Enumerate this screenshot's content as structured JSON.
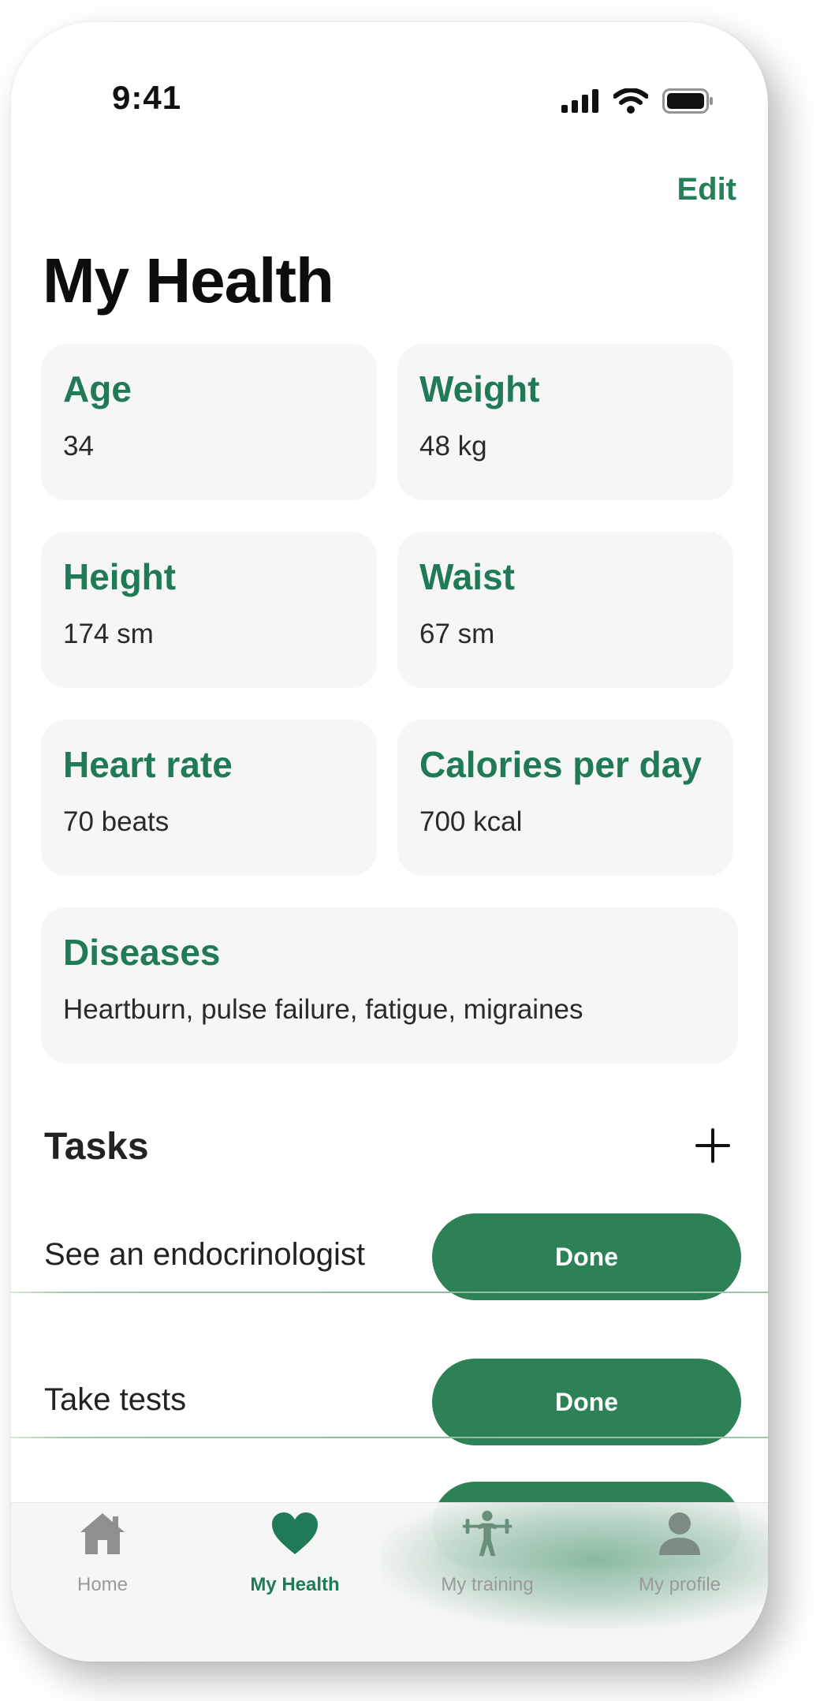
{
  "status_bar": {
    "time": "9:41"
  },
  "header": {
    "edit_label": "Edit",
    "title": "My Health"
  },
  "metrics": [
    {
      "title": "Age",
      "value": "34"
    },
    {
      "title": "Weight",
      "value": "48 kg"
    },
    {
      "title": "Height",
      "value": "174 sm"
    },
    {
      "title": "Waist",
      "value": "67 sm"
    },
    {
      "title": "Heart rate",
      "value": "70 beats"
    },
    {
      "title": "Calories per day",
      "value": "700 kcal"
    }
  ],
  "diseases": {
    "title": "Diseases",
    "value": "Heartburn, pulse failure, fatigue, migraines"
  },
  "tasks": {
    "heading": "Tasks",
    "items": [
      {
        "label": "See an endocrinologist",
        "button": "Done"
      },
      {
        "label": "Take tests",
        "button": "Done"
      }
    ]
  },
  "tabbar": {
    "tabs": [
      {
        "label": "Home",
        "icon": "home-icon"
      },
      {
        "label": "My Health",
        "icon": "heart-icon",
        "active": true
      },
      {
        "label": "My training",
        "icon": "barbell-icon"
      },
      {
        "label": "My profile",
        "icon": "person-icon"
      }
    ]
  },
  "colors": {
    "accent": "#1f7a55",
    "button": "#2c8256",
    "card_bg": "#f6f6f6"
  }
}
